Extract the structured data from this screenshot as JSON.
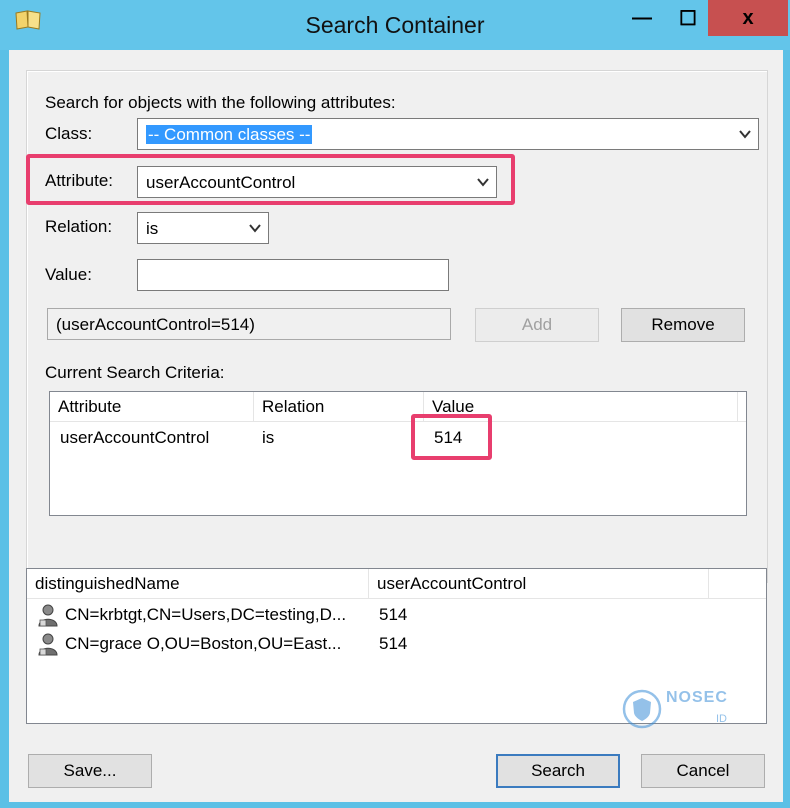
{
  "window": {
    "title": "Search Container",
    "minimize_glyph": "—",
    "maximize_glyph": "☐",
    "close_glyph": "x"
  },
  "criteria_group": {
    "heading": "Search for objects with the following attributes:",
    "class_label": "Class:",
    "class_value": "-- Common classes --",
    "attribute_label": "Attribute:",
    "attribute_value": "userAccountControl",
    "relation_label": "Relation:",
    "relation_value": "is",
    "value_label": "Value:",
    "value_value": "",
    "preview": "(userAccountControl=514)",
    "add_label": "Add",
    "remove_label": "Remove",
    "current_label": "Current Search Criteria:",
    "columns": [
      "Attribute",
      "Relation",
      "Value"
    ],
    "rows": [
      {
        "attribute": "userAccountControl",
        "relation": "is",
        "value": "514"
      }
    ]
  },
  "results": {
    "columns": [
      "distinguishedName",
      "userAccountControl"
    ],
    "rows": [
      {
        "dn": "CN=krbtgt,CN=Users,DC=testing,D...",
        "uac": "514",
        "icon": "user-icon"
      },
      {
        "dn": "CN=grace O,OU=Boston,OU=East...",
        "uac": "514",
        "icon": "user-icon"
      }
    ]
  },
  "footer": {
    "save_label": "Save...",
    "search_label": "Search",
    "cancel_label": "Cancel"
  },
  "watermark": {
    "text": "NOSEC",
    "sub": "ID"
  },
  "colors": {
    "titlebar": "#63c5ea",
    "close_button": "#c75050",
    "highlight_box": "#e83e6e",
    "selection": "#3399ff"
  }
}
